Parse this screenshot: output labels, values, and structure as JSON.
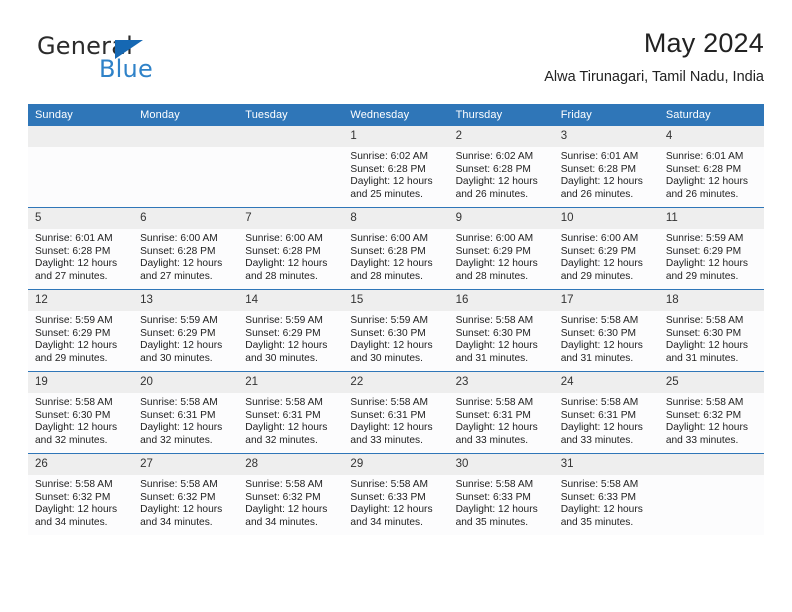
{
  "brand": {
    "name_top": "General",
    "name_bottom": "Blue",
    "accent_color": "#1668b3",
    "blue_text_color": "#2f82c8"
  },
  "header": {
    "title": "May 2024",
    "subtitle": "Alwa Tirunagari, Tamil Nadu, India"
  },
  "theme": {
    "header_row_bg": "#2f76b8",
    "daynum_bg": "#eeeeee",
    "cell_bg": "#fcfcfd"
  },
  "weekdays": [
    "Sunday",
    "Monday",
    "Tuesday",
    "Wednesday",
    "Thursday",
    "Friday",
    "Saturday"
  ],
  "weeks": [
    [
      {
        "day": "",
        "empty": true
      },
      {
        "day": "",
        "empty": true
      },
      {
        "day": "",
        "empty": true
      },
      {
        "day": "1",
        "sunrise": "Sunrise: 6:02 AM",
        "sunset": "Sunset: 6:28 PM",
        "daylight1": "Daylight: 12 hours",
        "daylight2": "and 25 minutes."
      },
      {
        "day": "2",
        "sunrise": "Sunrise: 6:02 AM",
        "sunset": "Sunset: 6:28 PM",
        "daylight1": "Daylight: 12 hours",
        "daylight2": "and 26 minutes."
      },
      {
        "day": "3",
        "sunrise": "Sunrise: 6:01 AM",
        "sunset": "Sunset: 6:28 PM",
        "daylight1": "Daylight: 12 hours",
        "daylight2": "and 26 minutes."
      },
      {
        "day": "4",
        "sunrise": "Sunrise: 6:01 AM",
        "sunset": "Sunset: 6:28 PM",
        "daylight1": "Daylight: 12 hours",
        "daylight2": "and 26 minutes."
      }
    ],
    [
      {
        "day": "5",
        "sunrise": "Sunrise: 6:01 AM",
        "sunset": "Sunset: 6:28 PM",
        "daylight1": "Daylight: 12 hours",
        "daylight2": "and 27 minutes."
      },
      {
        "day": "6",
        "sunrise": "Sunrise: 6:00 AM",
        "sunset": "Sunset: 6:28 PM",
        "daylight1": "Daylight: 12 hours",
        "daylight2": "and 27 minutes."
      },
      {
        "day": "7",
        "sunrise": "Sunrise: 6:00 AM",
        "sunset": "Sunset: 6:28 PM",
        "daylight1": "Daylight: 12 hours",
        "daylight2": "and 28 minutes."
      },
      {
        "day": "8",
        "sunrise": "Sunrise: 6:00 AM",
        "sunset": "Sunset: 6:28 PM",
        "daylight1": "Daylight: 12 hours",
        "daylight2": "and 28 minutes."
      },
      {
        "day": "9",
        "sunrise": "Sunrise: 6:00 AM",
        "sunset": "Sunset: 6:29 PM",
        "daylight1": "Daylight: 12 hours",
        "daylight2": "and 28 minutes."
      },
      {
        "day": "10",
        "sunrise": "Sunrise: 6:00 AM",
        "sunset": "Sunset: 6:29 PM",
        "daylight1": "Daylight: 12 hours",
        "daylight2": "and 29 minutes."
      },
      {
        "day": "11",
        "sunrise": "Sunrise: 5:59 AM",
        "sunset": "Sunset: 6:29 PM",
        "daylight1": "Daylight: 12 hours",
        "daylight2": "and 29 minutes."
      }
    ],
    [
      {
        "day": "12",
        "sunrise": "Sunrise: 5:59 AM",
        "sunset": "Sunset: 6:29 PM",
        "daylight1": "Daylight: 12 hours",
        "daylight2": "and 29 minutes."
      },
      {
        "day": "13",
        "sunrise": "Sunrise: 5:59 AM",
        "sunset": "Sunset: 6:29 PM",
        "daylight1": "Daylight: 12 hours",
        "daylight2": "and 30 minutes."
      },
      {
        "day": "14",
        "sunrise": "Sunrise: 5:59 AM",
        "sunset": "Sunset: 6:29 PM",
        "daylight1": "Daylight: 12 hours",
        "daylight2": "and 30 minutes."
      },
      {
        "day": "15",
        "sunrise": "Sunrise: 5:59 AM",
        "sunset": "Sunset: 6:30 PM",
        "daylight1": "Daylight: 12 hours",
        "daylight2": "and 30 minutes."
      },
      {
        "day": "16",
        "sunrise": "Sunrise: 5:58 AM",
        "sunset": "Sunset: 6:30 PM",
        "daylight1": "Daylight: 12 hours",
        "daylight2": "and 31 minutes."
      },
      {
        "day": "17",
        "sunrise": "Sunrise: 5:58 AM",
        "sunset": "Sunset: 6:30 PM",
        "daylight1": "Daylight: 12 hours",
        "daylight2": "and 31 minutes."
      },
      {
        "day": "18",
        "sunrise": "Sunrise: 5:58 AM",
        "sunset": "Sunset: 6:30 PM",
        "daylight1": "Daylight: 12 hours",
        "daylight2": "and 31 minutes."
      }
    ],
    [
      {
        "day": "19",
        "sunrise": "Sunrise: 5:58 AM",
        "sunset": "Sunset: 6:30 PM",
        "daylight1": "Daylight: 12 hours",
        "daylight2": "and 32 minutes."
      },
      {
        "day": "20",
        "sunrise": "Sunrise: 5:58 AM",
        "sunset": "Sunset: 6:31 PM",
        "daylight1": "Daylight: 12 hours",
        "daylight2": "and 32 minutes."
      },
      {
        "day": "21",
        "sunrise": "Sunrise: 5:58 AM",
        "sunset": "Sunset: 6:31 PM",
        "daylight1": "Daylight: 12 hours",
        "daylight2": "and 32 minutes."
      },
      {
        "day": "22",
        "sunrise": "Sunrise: 5:58 AM",
        "sunset": "Sunset: 6:31 PM",
        "daylight1": "Daylight: 12 hours",
        "daylight2": "and 33 minutes."
      },
      {
        "day": "23",
        "sunrise": "Sunrise: 5:58 AM",
        "sunset": "Sunset: 6:31 PM",
        "daylight1": "Daylight: 12 hours",
        "daylight2": "and 33 minutes."
      },
      {
        "day": "24",
        "sunrise": "Sunrise: 5:58 AM",
        "sunset": "Sunset: 6:31 PM",
        "daylight1": "Daylight: 12 hours",
        "daylight2": "and 33 minutes."
      },
      {
        "day": "25",
        "sunrise": "Sunrise: 5:58 AM",
        "sunset": "Sunset: 6:32 PM",
        "daylight1": "Daylight: 12 hours",
        "daylight2": "and 33 minutes."
      }
    ],
    [
      {
        "day": "26",
        "sunrise": "Sunrise: 5:58 AM",
        "sunset": "Sunset: 6:32 PM",
        "daylight1": "Daylight: 12 hours",
        "daylight2": "and 34 minutes."
      },
      {
        "day": "27",
        "sunrise": "Sunrise: 5:58 AM",
        "sunset": "Sunset: 6:32 PM",
        "daylight1": "Daylight: 12 hours",
        "daylight2": "and 34 minutes."
      },
      {
        "day": "28",
        "sunrise": "Sunrise: 5:58 AM",
        "sunset": "Sunset: 6:32 PM",
        "daylight1": "Daylight: 12 hours",
        "daylight2": "and 34 minutes."
      },
      {
        "day": "29",
        "sunrise": "Sunrise: 5:58 AM",
        "sunset": "Sunset: 6:33 PM",
        "daylight1": "Daylight: 12 hours",
        "daylight2": "and 34 minutes."
      },
      {
        "day": "30",
        "sunrise": "Sunrise: 5:58 AM",
        "sunset": "Sunset: 6:33 PM",
        "daylight1": "Daylight: 12 hours",
        "daylight2": "and 35 minutes."
      },
      {
        "day": "31",
        "sunrise": "Sunrise: 5:58 AM",
        "sunset": "Sunset: 6:33 PM",
        "daylight1": "Daylight: 12 hours",
        "daylight2": "and 35 minutes."
      },
      {
        "day": "",
        "empty": true
      }
    ]
  ]
}
